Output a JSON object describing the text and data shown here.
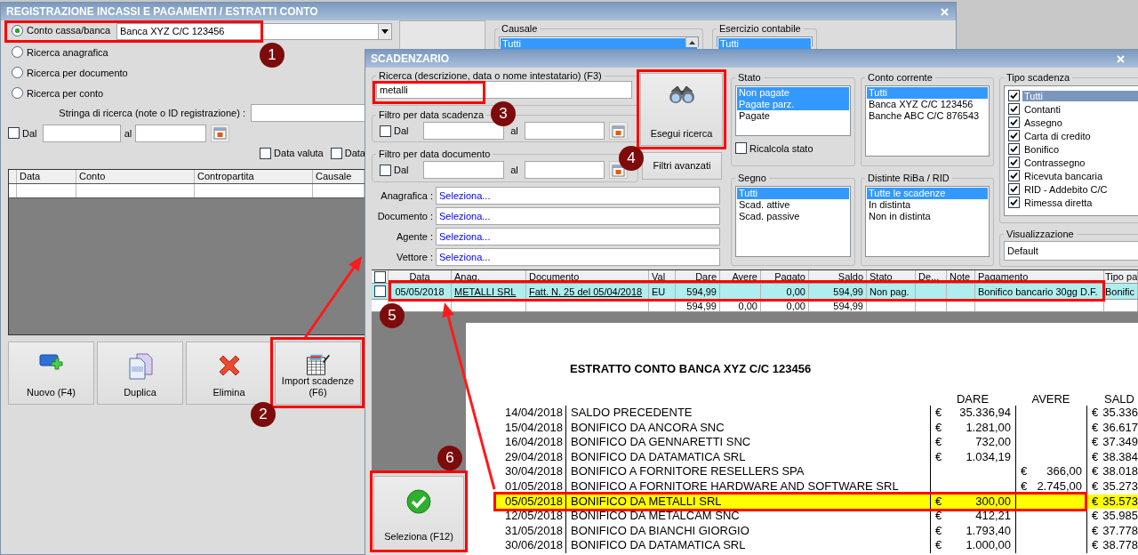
{
  "main_window": {
    "title": "REGISTRAZIONE INCASSI E PAGAMENTI / ESTRATTI CONTO",
    "search_modes": [
      {
        "label": "Conto cassa/banca",
        "selected": true
      },
      {
        "label": "Ricerca anagrafica",
        "selected": false
      },
      {
        "label": "Ricerca per documento",
        "selected": false
      },
      {
        "label": "Ricerca per conto",
        "selected": false
      }
    ],
    "account_select": {
      "value": "Banca XYZ C/C 123456"
    },
    "causale": {
      "title": "Causale",
      "items": [
        {
          "label": "Tutti",
          "selected": true
        }
      ]
    },
    "esercizio": {
      "title": "Esercizio contabile",
      "items": [
        {
          "label": "Tutti",
          "selected": true
        }
      ]
    },
    "search_string": {
      "label": "Stringa di ricerca (note o ID registrazione) :"
    },
    "date_range": {
      "from_label": "Dal",
      "checked": false,
      "to_label": "al"
    },
    "date_options": [
      {
        "label": "Data valuta",
        "checked": false
      },
      {
        "label": "Data",
        "checked": false
      }
    ],
    "table": {
      "columns": [
        "Data",
        "Conto",
        "Contropartita",
        "Causale"
      ]
    },
    "buttons": [
      {
        "kind": "new",
        "label": "Nuovo (F4)"
      },
      {
        "kind": "duplicate",
        "label": "Duplica"
      },
      {
        "kind": "delete",
        "label": "Elimina"
      },
      {
        "kind": "import",
        "label": "Import scadenze (F6)"
      }
    ]
  },
  "scadenzario": {
    "title": "SCADENZARIO",
    "search": {
      "title": "Ricerca (descrizione, data o nome intestatario) (F3)",
      "value": "metalli"
    },
    "date_filters": [
      {
        "title": "Filtro per data scadenza",
        "from_label": "Dal",
        "checked": false,
        "to_label": "al"
      },
      {
        "title": "Filtro per data documento",
        "from_label": "Dal",
        "checked": false,
        "to_label": "al"
      }
    ],
    "search_button": {
      "label": "Esegui ricerca"
    },
    "advanced_button": {
      "label": "Filtri avanzati"
    },
    "lookups": [
      {
        "label": "Anagrafica :",
        "value": "Seleziona..."
      },
      {
        "label": "Documento :",
        "value": "Seleziona..."
      },
      {
        "label": "Agente :",
        "value": "Seleziona..."
      },
      {
        "label": "Vettore :",
        "value": "Seleziona..."
      }
    ],
    "stato": {
      "title": "Stato",
      "items": [
        {
          "label": "Non pagate",
          "selected": true
        },
        {
          "label": "Pagate parz.",
          "selected": true
        },
        {
          "label": "Pagate",
          "selected": false
        }
      ]
    },
    "recalc": {
      "label": "Ricalcola stato",
      "checked": false
    },
    "segno": {
      "title": "Segno",
      "items": [
        {
          "label": "Tutti",
          "selected": true
        },
        {
          "label": "Scad. attive",
          "selected": false
        },
        {
          "label": "Scad. passive",
          "selected": false
        }
      ]
    },
    "conto_corrente": {
      "title": "Conto corrente",
      "items": [
        {
          "label": "Tutti",
          "selected": true
        },
        {
          "label": "Banca XYZ C/C 123456",
          "selected": false
        },
        {
          "label": "Banche ABC C/C 876543",
          "selected": false
        }
      ]
    },
    "distinte": {
      "title": "Distinte RiBa / RID",
      "items": [
        {
          "label": "Tutte le scadenze",
          "selected": true
        },
        {
          "label": "In distinta",
          "selected": false
        },
        {
          "label": "Non in distinta",
          "selected": false
        }
      ]
    },
    "tipo_scadenza": {
      "title": "Tipo scadenza",
      "items": [
        {
          "label": "Tutti",
          "checked": true,
          "selected": true
        },
        {
          "label": "Contanti",
          "checked": true,
          "selected": false
        },
        {
          "label": "Assegno",
          "checked": true,
          "selected": false
        },
        {
          "label": "Carta di credito",
          "checked": true,
          "selected": false
        },
        {
          "label": "Bonifico",
          "checked": true,
          "selected": false
        },
        {
          "label": "Contrassegno",
          "checked": true,
          "selected": false
        },
        {
          "label": "Ricevuta bancaria",
          "checked": true,
          "selected": false
        },
        {
          "label": "RID - Addebito C/C",
          "checked": true,
          "selected": false
        },
        {
          "label": "Rimessa diretta",
          "checked": true,
          "selected": false
        }
      ]
    },
    "visualizzazione": {
      "title": "Visualizzazione",
      "value": "Default"
    },
    "grid": {
      "header_checked": false,
      "columns": [
        "Data",
        "Anag.",
        "Documento",
        "Val",
        "Dare",
        "Avere",
        "Pagato",
        "Saldo",
        "Stato",
        "De...",
        "Note",
        "Pagamento",
        "Tipo pa"
      ],
      "rows": [
        {
          "checked": false,
          "selected": true,
          "data": "05/05/2018",
          "anag": "METALLI SRL",
          "documento": "Fatt. N. 25 del 05/04/2018",
          "val": "EU",
          "dare": "594,99",
          "pagato": "0,00",
          "saldo": "594,99",
          "stato": "Non pag.",
          "pagamento": "Bonifico bancario 30gg D.F.",
          "tipo": "Bonific"
        }
      ],
      "totals": {
        "dare": "594,99",
        "avere": "0,00",
        "pagato": "0,00",
        "saldo": "594,99"
      }
    },
    "select_button": {
      "label": "Seleziona (F12)"
    }
  },
  "statement": {
    "title": "ESTRATTO CONTO BANCA XYZ C/C 123456",
    "headers": {
      "dare": "DARE",
      "avere": "AVERE",
      "saldo": "SALD"
    },
    "rows": [
      {
        "date": "14/04/2018",
        "description": "SALDO PRECEDENTE",
        "dare": {
          "currency": "€",
          "amount": "35.336,94"
        },
        "saldo": {
          "currency": "€",
          "amount": "35.336"
        },
        "highlighted": false
      },
      {
        "date": "15/04/2018",
        "description": "BONIFICO DA ANCORA SNC",
        "dare": {
          "currency": "€",
          "amount": "1.281,00"
        },
        "saldo": {
          "currency": "€",
          "amount": "36.617"
        },
        "highlighted": false
      },
      {
        "date": "16/04/2018",
        "description": "BONIFICO DA GENNARETTI SNC",
        "dare": {
          "currency": "€",
          "amount": "732,00"
        },
        "saldo": {
          "currency": "€",
          "amount": "37.349"
        },
        "highlighted": false
      },
      {
        "date": "29/04/2018",
        "description": "BONIFICO DA DATAMATICA SRL",
        "dare": {
          "currency": "€",
          "amount": "1.034,19"
        },
        "saldo": {
          "currency": "€",
          "amount": "38.384"
        },
        "highlighted": false
      },
      {
        "date": "30/04/2018",
        "description": "BONIFICO A FORNITORE RESELLERS SPA",
        "avere": {
          "currency": "€",
          "amount": "366,00"
        },
        "saldo": {
          "currency": "€",
          "amount": "38.018"
        },
        "highlighted": false
      },
      {
        "date": "01/05/2018",
        "description": "BONIFICO A FORNITORE HARDWARE AND SOFTWARE SRL",
        "avere": {
          "currency": "€",
          "amount": "2.745,00"
        },
        "saldo": {
          "currency": "€",
          "amount": "35.273"
        },
        "highlighted": false
      },
      {
        "date": "05/05/2018",
        "description": "BONIFICO DA METALLI SRL",
        "dare": {
          "currency": "€",
          "amount": "300,00"
        },
        "saldo": {
          "currency": "€",
          "amount": "35.573"
        },
        "highlighted": true
      },
      {
        "date": "12/05/2018",
        "description": "BONIFICO DA METALCAM SNC",
        "dare": {
          "currency": "€",
          "amount": "412,21"
        },
        "saldo": {
          "currency": "€",
          "amount": "35.985"
        },
        "highlighted": false
      },
      {
        "date": "31/05/2018",
        "description": "BONIFICO DA BIANCHI GIORGIO",
        "dare": {
          "currency": "€",
          "amount": "1.793,40"
        },
        "saldo": {
          "currency": "€",
          "amount": "37.778"
        },
        "highlighted": false
      },
      {
        "date": "30/06/2018",
        "description": "BONIFICO DA DATAMATICA SRL",
        "dare": {
          "currency": "€",
          "amount": "1.000,00"
        },
        "saldo": {
          "currency": "€",
          "amount": "38.778"
        },
        "highlighted": false
      }
    ]
  },
  "callouts": [
    {
      "number": "1"
    },
    {
      "number": "2"
    },
    {
      "number": "3"
    },
    {
      "number": "4"
    },
    {
      "number": "5"
    },
    {
      "number": "6"
    }
  ]
}
